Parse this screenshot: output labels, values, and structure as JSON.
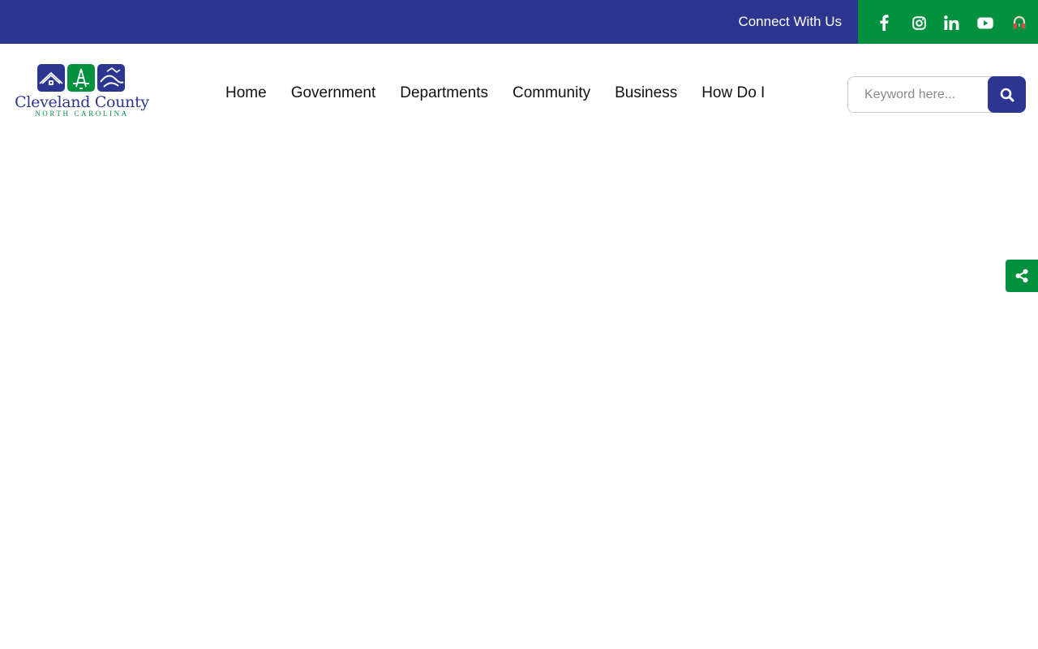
{
  "topbar": {
    "connect_label": "Connect With Us",
    "background": "#2c3690",
    "social_background": "#03913f",
    "social_icons": [
      "facebook-icon",
      "instagram-icon",
      "linkedin-icon",
      "youtube-icon",
      "accessibility-icon"
    ]
  },
  "logo": {
    "name": "Cleveland County",
    "subtitle": "NORTH CAROLINA"
  },
  "nav": {
    "items": [
      {
        "label": "Home"
      },
      {
        "label": "Government"
      },
      {
        "label": "Departments"
      },
      {
        "label": "Community"
      },
      {
        "label": "Business"
      },
      {
        "label": "How Do I"
      }
    ]
  },
  "search": {
    "placeholder": "Keyword here...",
    "value": "",
    "button_icon": "search-icon"
  },
  "share": {
    "icon": "share-icon"
  },
  "colors": {
    "primary": "#2c3690",
    "accent": "#03913f"
  }
}
